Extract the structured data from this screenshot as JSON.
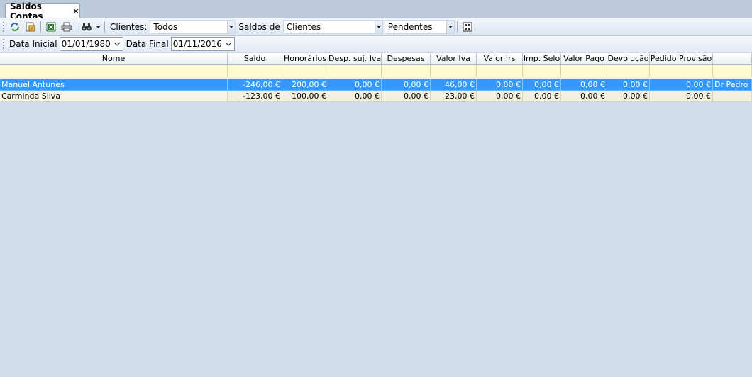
{
  "tab": {
    "title": "Saldos Contas",
    "close": "✕"
  },
  "toolbar": {
    "clientes_label": "Clientes:",
    "clientes_value": "Todos",
    "saldos_label": "Saldos de",
    "saldos_value": "Clientes",
    "estado_value": "Pendentes"
  },
  "filters": {
    "data_inicial_label": "Data Inicial",
    "data_inicial_value": "01/01/1980",
    "data_final_label": "Data Final",
    "data_final_value": "01/11/2016"
  },
  "columns": [
    "Nome",
    "Saldo",
    "Honorários",
    "Desp. suj. Iva",
    "Despesas",
    "Valor Iva",
    "Valor Irs",
    "Imp. Selo",
    "Valor Pago",
    "Devolução",
    "Pedido Provisão",
    ""
  ],
  "rows": [
    [
      "Manuel Antunes",
      "-246,00 €",
      "200,00 €",
      "0,00 €",
      "0,00 €",
      "46,00 €",
      "0,00 €",
      "0,00 €",
      "0,00 €",
      "0,00 €",
      "0,00 €",
      "Dr Pedro S"
    ],
    [
      "Carminda Silva",
      "-123,00 €",
      "100,00 €",
      "0,00 €",
      "0,00 €",
      "23,00 €",
      "0,00 €",
      "0,00 €",
      "0,00 €",
      "0,00 €",
      "0,00 €",
      ""
    ]
  ],
  "colors": {
    "selection": "#3399ff",
    "filter_row": "#fffbd1",
    "background": "#cfdcea"
  }
}
